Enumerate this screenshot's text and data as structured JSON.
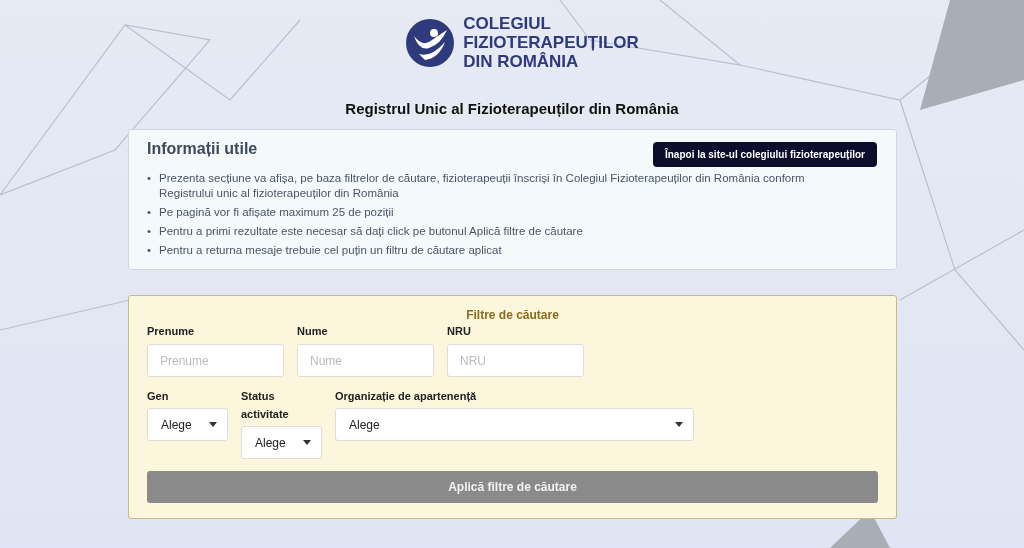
{
  "logo": {
    "lines": [
      "COLEGIUL",
      "FIZIOTERAPEUȚILOR",
      "DIN ROMÂNIA"
    ]
  },
  "page_title": "Registrul Unic al Fizioterapeuților din România",
  "info": {
    "title": "Informații utile",
    "back_button": "Înapoi la site-ul colegiului fizioterapeuților",
    "bullet": "•",
    "items": [
      "Prezenta secțiune va afișa, pe baza filtrelor de căutare, fizioterapeuții înscriși în Colegiul Fizioterapeuților din România conform Registrului unic al fizioterapeuților din România",
      "Pe pagină vor fi afișate maximum 25 de poziții",
      "Pentru a primi rezultate este necesar să dați click pe butonul Aplică filtre de căutare",
      "Pentru a returna mesaje trebuie cel puțin un filtru de căutare aplicat"
    ]
  },
  "filters": {
    "title": "Filtre de căutare",
    "rows": [
      [
        {
          "kind": "text",
          "label": "Prenume",
          "placeholder": "Prenume"
        },
        {
          "kind": "text",
          "label": "Nume",
          "placeholder": "Nume"
        },
        {
          "kind": "text",
          "label": "NRU",
          "placeholder": "NRU"
        }
      ],
      [
        {
          "kind": "select",
          "label": "Gen",
          "value": "Alege"
        },
        {
          "kind": "select",
          "label": "Status activitate",
          "value": "Alege"
        },
        {
          "kind": "select",
          "label": "Organizație de apartenență",
          "value": "Alege"
        }
      ]
    ],
    "apply_button": "Aplică filtre de căutare"
  }
}
